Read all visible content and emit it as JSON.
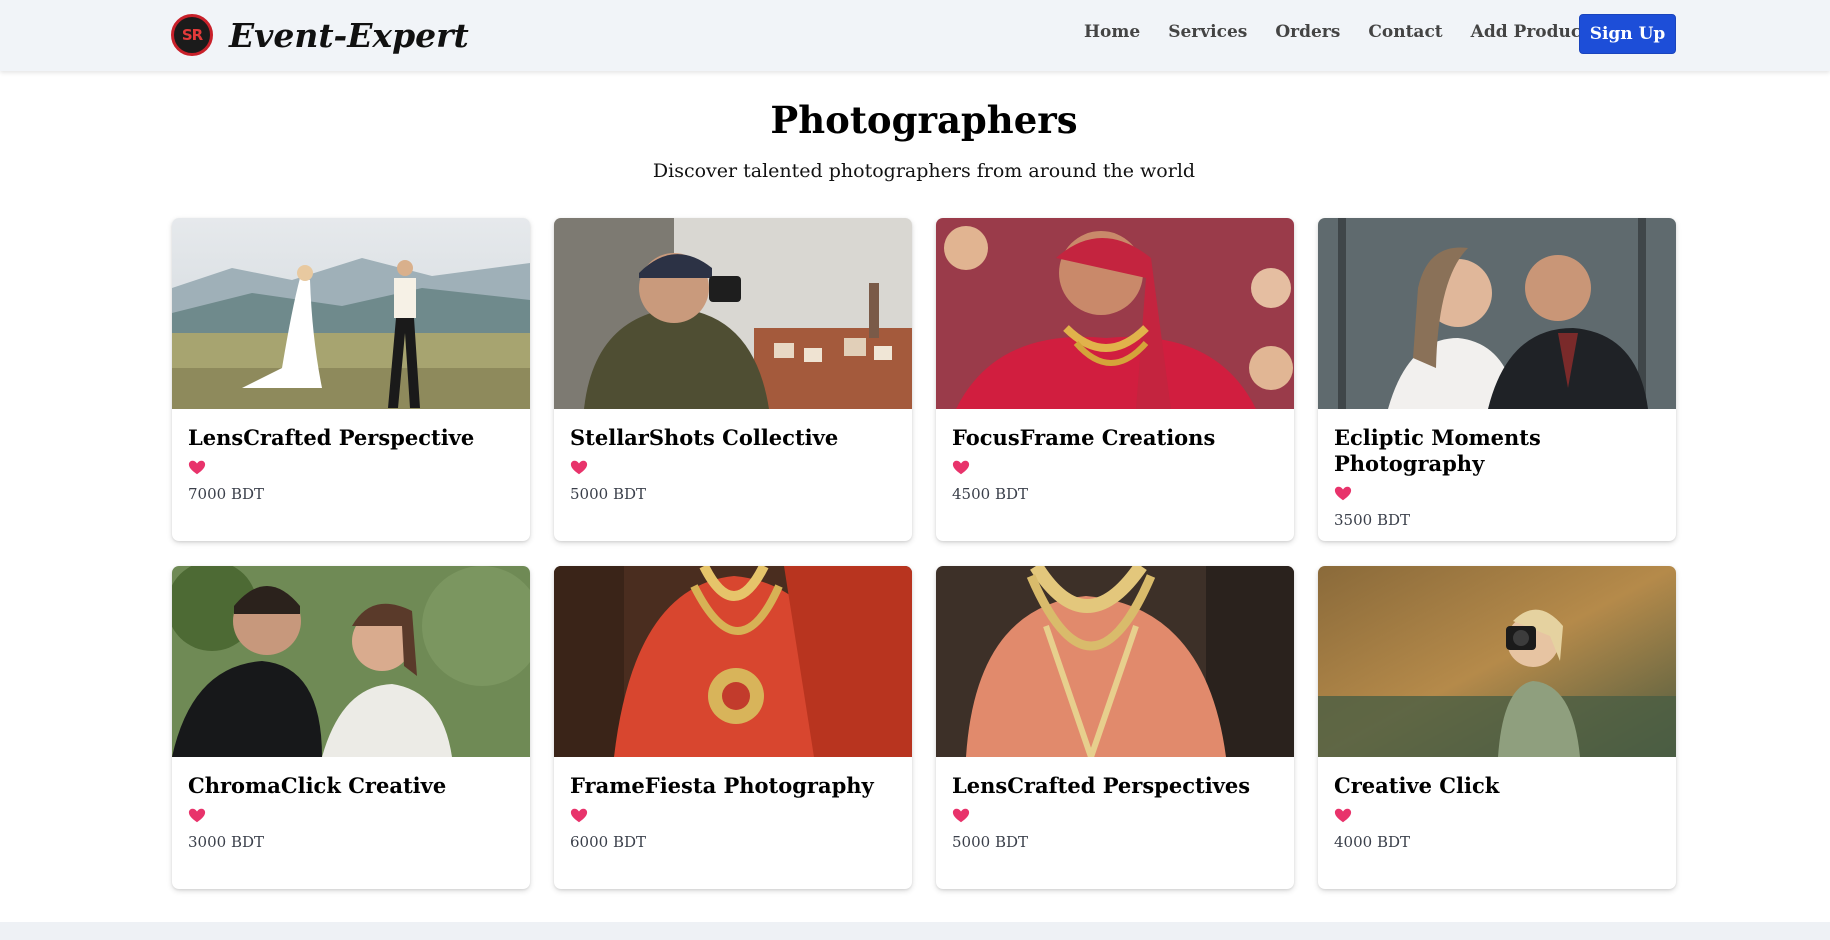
{
  "header": {
    "logo_text": "SR",
    "brand": "Event-Expert",
    "nav": [
      "Home",
      "Services",
      "Orders",
      "Contact",
      "Add Product"
    ],
    "signup_label": "Sign Up"
  },
  "main": {
    "title": "Photographers",
    "subtitle": "Discover talented photographers from around the world"
  },
  "cards": [
    {
      "name": "LensCrafted Perspective",
      "price": "7000 BDT"
    },
    {
      "name": "StellarShots Collective",
      "price": "5000 BDT"
    },
    {
      "name": "FocusFrame Creations",
      "price": "4500 BDT"
    },
    {
      "name": "Ecliptic Moments Photography",
      "price": "3500 BDT"
    },
    {
      "name": "ChromaClick Creative",
      "price": "3000 BDT"
    },
    {
      "name": "FrameFiesta Photography",
      "price": "6000 BDT"
    },
    {
      "name": "LensCrafted Perspectives",
      "price": "5000 BDT"
    },
    {
      "name": "Creative Click",
      "price": "4000 BDT"
    }
  ],
  "colors": {
    "accent": "#1d4ed8",
    "heart": "#e8336b",
    "nav_bg": "#f1f4f8"
  }
}
